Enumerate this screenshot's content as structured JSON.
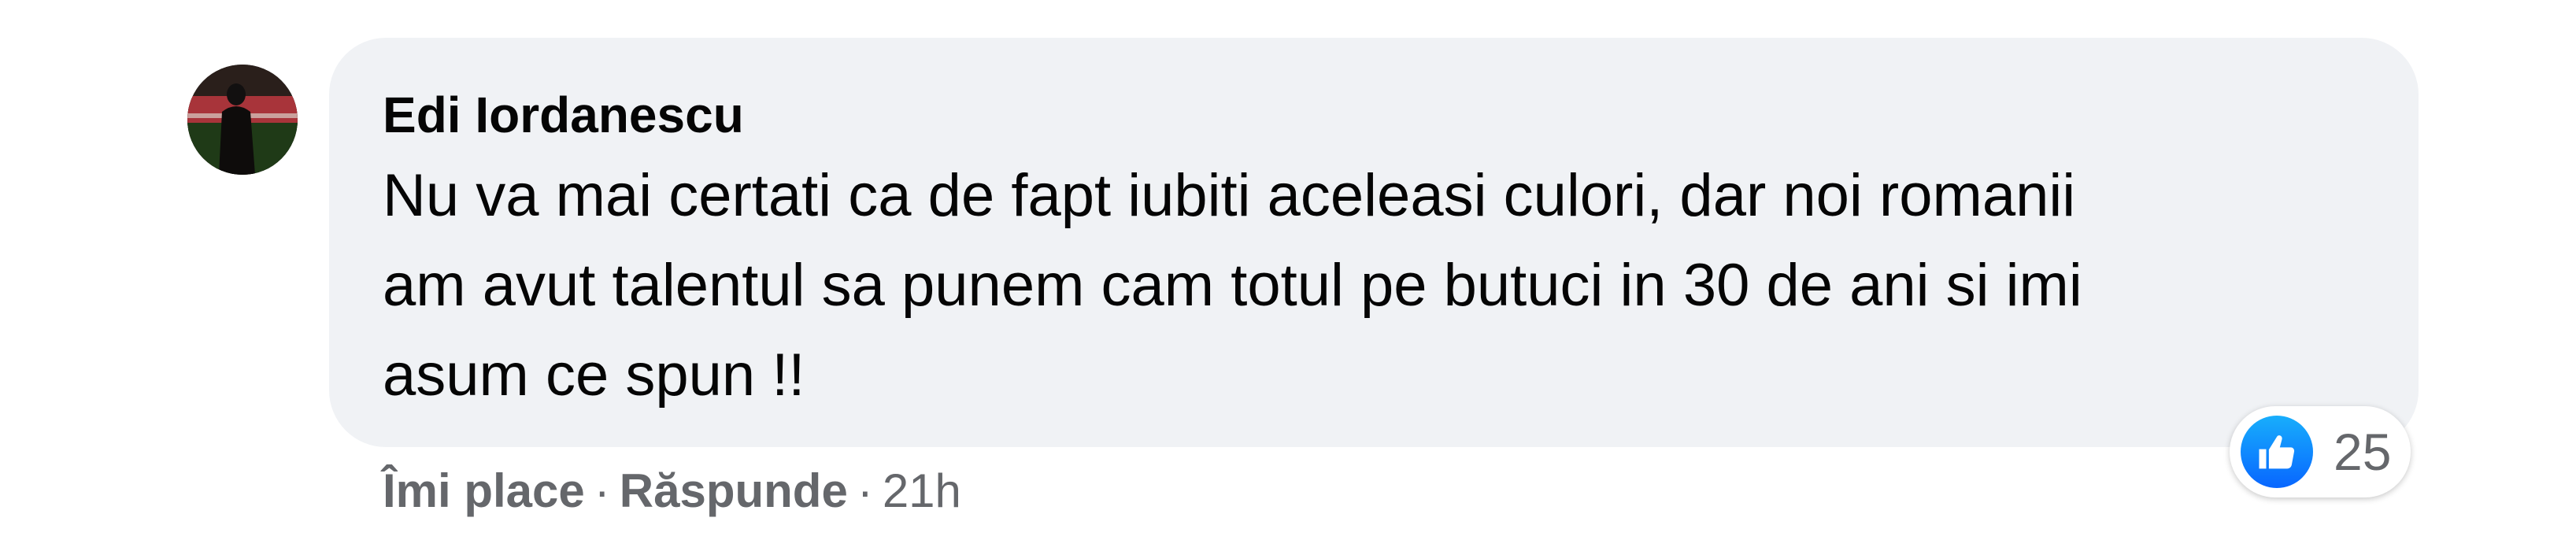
{
  "comment": {
    "author": "Edi Iordanescu",
    "text_lines": [
      "Nu va mai certati ca de fapt iubiti aceleasi culori, dar noi romanii",
      "am avut talentul sa punem cam totul pe butuci in 30 de ani si imi",
      "asum ce spun !!"
    ],
    "reactions": {
      "type": "like",
      "count": "25"
    },
    "actions": {
      "like_label": "Îmi place",
      "reply_label": "Răspunde",
      "separator": "·",
      "timestamp": "21h"
    }
  },
  "colors": {
    "bubble_bg": "#f0f2f5",
    "secondary_text": "#65676b",
    "like_blue": "#0866ff"
  },
  "icons": {
    "like": "thumbs-up-icon"
  }
}
